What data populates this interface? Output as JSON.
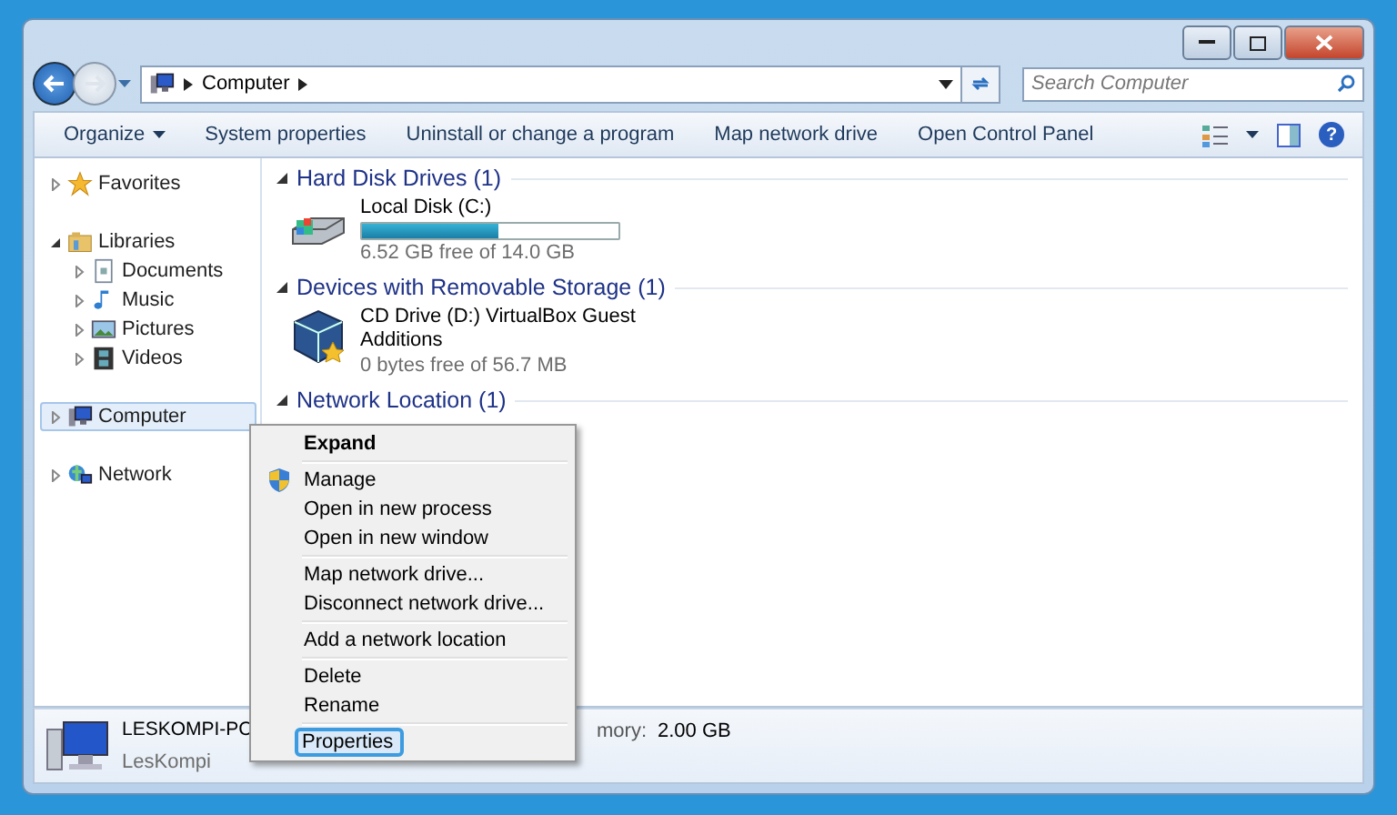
{
  "address_bar": {
    "path": [
      {
        "label": "Computer"
      }
    ]
  },
  "search": {
    "placeholder": "Search Computer"
  },
  "toolbar": {
    "buttons": [
      {
        "label": "Organize",
        "kind": "menu"
      },
      {
        "label": "System properties",
        "kind": "plain"
      },
      {
        "label": "Uninstall or change a program",
        "kind": "plain"
      },
      {
        "label": "Map network drive",
        "kind": "plain"
      },
      {
        "label": "Open Control Panel",
        "kind": "plain"
      }
    ]
  },
  "help_button": {
    "label": "?"
  },
  "sidebar": {
    "items": [
      {
        "label": "Favorites",
        "expanded": false,
        "selected": false
      },
      {
        "label": "Libraries",
        "expanded": true,
        "selected": false,
        "children": [
          {
            "label": "Documents",
            "expanded": false,
            "selected": false
          },
          {
            "label": "Music",
            "expanded": false,
            "selected": false
          },
          {
            "label": "Pictures",
            "expanded": false,
            "selected": false
          },
          {
            "label": "Videos",
            "expanded": false,
            "selected": false
          }
        ]
      },
      {
        "label": "Computer",
        "expanded": false,
        "selected": true
      },
      {
        "label": "Network",
        "expanded": false,
        "selected": false
      }
    ]
  },
  "groups": [
    {
      "title": "Hard Disk Drives (1)",
      "items": [
        {
          "kind": "disk",
          "name": "Local Disk (C:)",
          "level": 0.53,
          "free": "6.52 GB free of 14.0 GB"
        }
      ]
    },
    {
      "title": "Devices with Removable Storage (1)",
      "items": [
        {
          "kind": "cd",
          "name": "CD Drive (D:) VirtualBox Guest Additions",
          "free": "0 bytes free of 56.7 MB"
        }
      ]
    },
    {
      "title": "Network Location (1)"
    }
  ],
  "context_menu": {
    "groups": [
      [
        {
          "label": "Expand",
          "kind": "default",
          "selected": false
        }
      ],
      [
        {
          "label": "Manage",
          "kind": "elevated",
          "selected": false
        },
        {
          "label": "Open in new process",
          "kind": "plain",
          "selected": false
        },
        {
          "label": "Open in new window",
          "kind": "plain",
          "selected": false
        }
      ],
      [
        {
          "label": "Map network drive...",
          "kind": "plain",
          "selected": false
        },
        {
          "label": "Disconnect network drive...",
          "kind": "plain",
          "selected": false
        }
      ],
      [
        {
          "label": "Add a network location",
          "kind": "plain",
          "selected": false
        }
      ],
      [
        {
          "label": "Delete",
          "kind": "plain",
          "selected": false
        },
        {
          "label": "Rename",
          "kind": "plain",
          "selected": false
        }
      ],
      [
        {
          "label": "Properties",
          "kind": "plain",
          "selected": true
        }
      ]
    ]
  },
  "details_pane": {
    "name": "LESKOMPI-PC",
    "workgroup": "LesKompi",
    "memory_label": "mory:",
    "memory_value": "2.00 GB"
  }
}
